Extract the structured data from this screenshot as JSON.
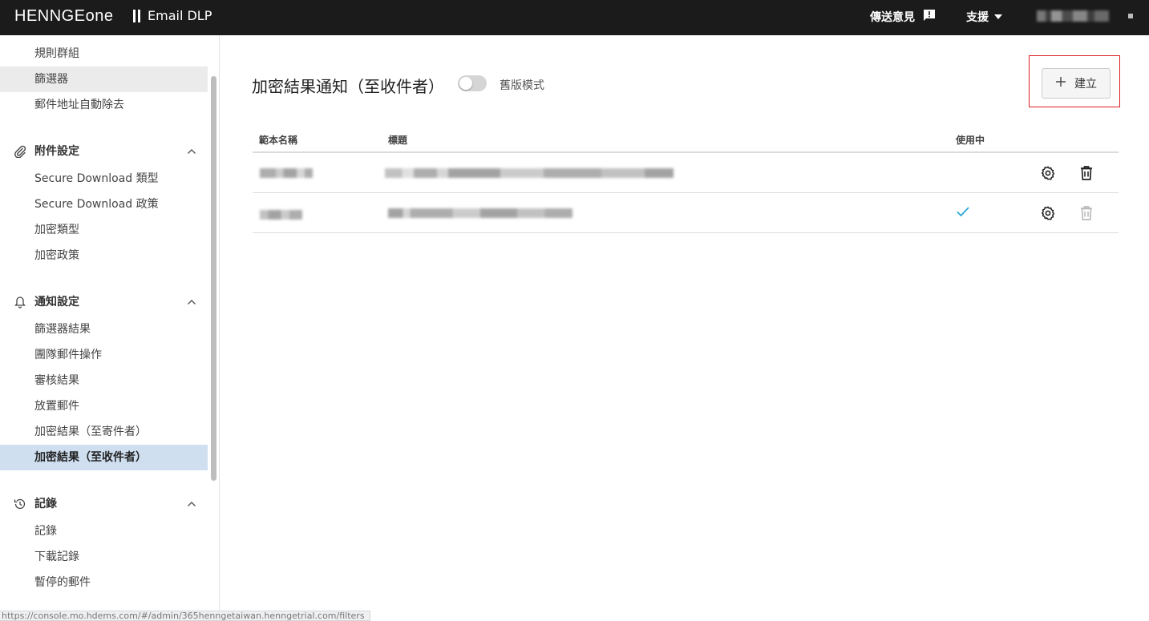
{
  "topbar": {
    "brand_prefix": "HENNGE",
    "brand_suffix": "one",
    "product": "Email DLP",
    "feedback": "傳送意見",
    "support": "支援"
  },
  "sidebar": {
    "top_items": [
      "規則群組",
      "篩選器",
      "郵件地址自動除去"
    ],
    "attach_section": "附件設定",
    "attach_items": [
      "Secure Download 類型",
      "Secure Download 政策",
      "加密類型",
      "加密政策"
    ],
    "notify_section": "通知設定",
    "notify_items": [
      "篩選器結果",
      "團隊郵件操作",
      "審核結果",
      "放置郵件",
      "加密結果（至寄件者）",
      "加密結果（至收件者）"
    ],
    "log_section": "記錄",
    "log_items": [
      "記錄",
      "下載記錄",
      "暫停的郵件"
    ]
  },
  "status_url": "https://console.mo.hdems.com/#/admin/365henngetaiwan.henngetrial.com/filters",
  "main": {
    "title": "加密結果通知（至收件者）",
    "legacy_label": "舊版模式",
    "legacy_on": false,
    "create_label": "建立",
    "columns": [
      "範本名稱",
      "標題",
      "使用中"
    ],
    "rows": [
      {
        "in_use": false,
        "delete_enabled": true
      },
      {
        "in_use": true,
        "delete_enabled": false
      }
    ]
  },
  "colors": {
    "topbar": "#1b1b1b",
    "active_item": "#cfdff0",
    "check": "#29a8d8",
    "highlight": "#dd2222"
  }
}
